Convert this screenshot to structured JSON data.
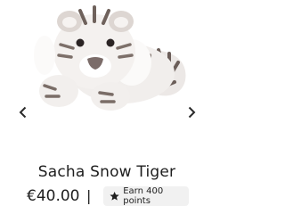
{
  "product": {
    "title": "Sacha Snow Tiger",
    "price": "€40.00",
    "separator": "|",
    "points_label": "Earn 400 points"
  },
  "carousel": {
    "prev_icon": "chevron-left-icon",
    "next_icon": "chevron-right-icon"
  },
  "icons": {
    "points": "star-icon"
  },
  "colors": {
    "text": "#1e1e1e",
    "badge_bg": "#f1f1f1",
    "arrow": "#2a2a2a"
  }
}
